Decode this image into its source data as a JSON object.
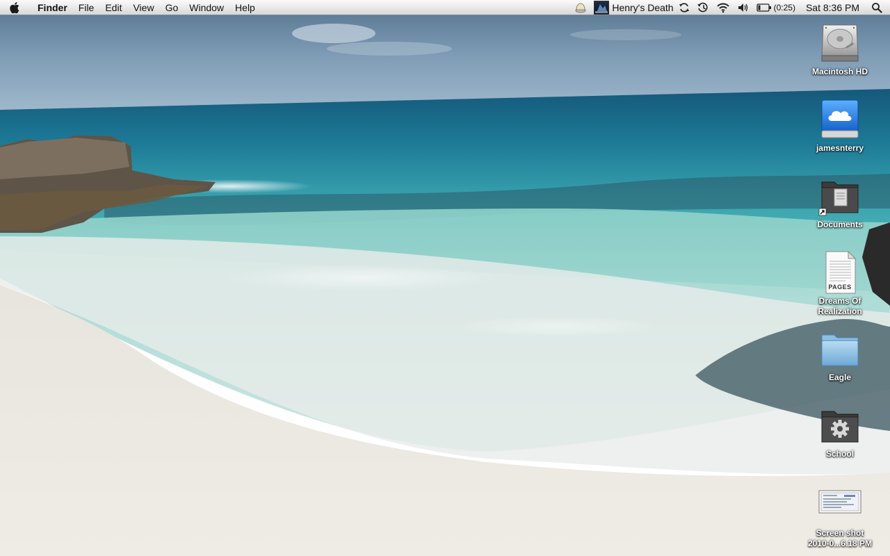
{
  "menubar": {
    "app_name": "Finder",
    "menus": [
      "File",
      "Edit",
      "View",
      "Go",
      "Window",
      "Help"
    ],
    "status": {
      "now_playing": "Henry's Death",
      "battery_time": "(0:25)",
      "clock": "Sat 8:36 PM"
    },
    "icons": [
      "apple-icon",
      "alert-icon",
      "album-art-icon",
      "sync-icon",
      "time-machine-icon",
      "wifi-icon",
      "volume-icon",
      "battery-icon",
      "spotlight-icon"
    ]
  },
  "desktop": {
    "icons": [
      {
        "label": "Macintosh HD",
        "kind": "hard-drive-icon"
      },
      {
        "label": "jamesnterry",
        "kind": "idisk-icon"
      },
      {
        "label": "Documents",
        "kind": "folder-alias-icon"
      },
      {
        "label_line1": "Dreams Of",
        "label_line2": "Realization",
        "kind": "pages-document-icon",
        "badge": "PAGES"
      },
      {
        "label": "Eagle",
        "kind": "folder-icon"
      },
      {
        "label": "School",
        "kind": "folder-gear-icon"
      },
      {
        "label_line1": "Screen shot",
        "label_line2": "2010-0...6.18 PM",
        "kind": "screenshot-thumbnail-icon"
      }
    ]
  },
  "colors": {
    "sky": "#7d9bb5",
    "ocean_deep": "#1a6e8f",
    "ocean_turquoise": "#4fb3b8",
    "sand": "#ece8e2",
    "menubar": "#e8e8e8"
  }
}
